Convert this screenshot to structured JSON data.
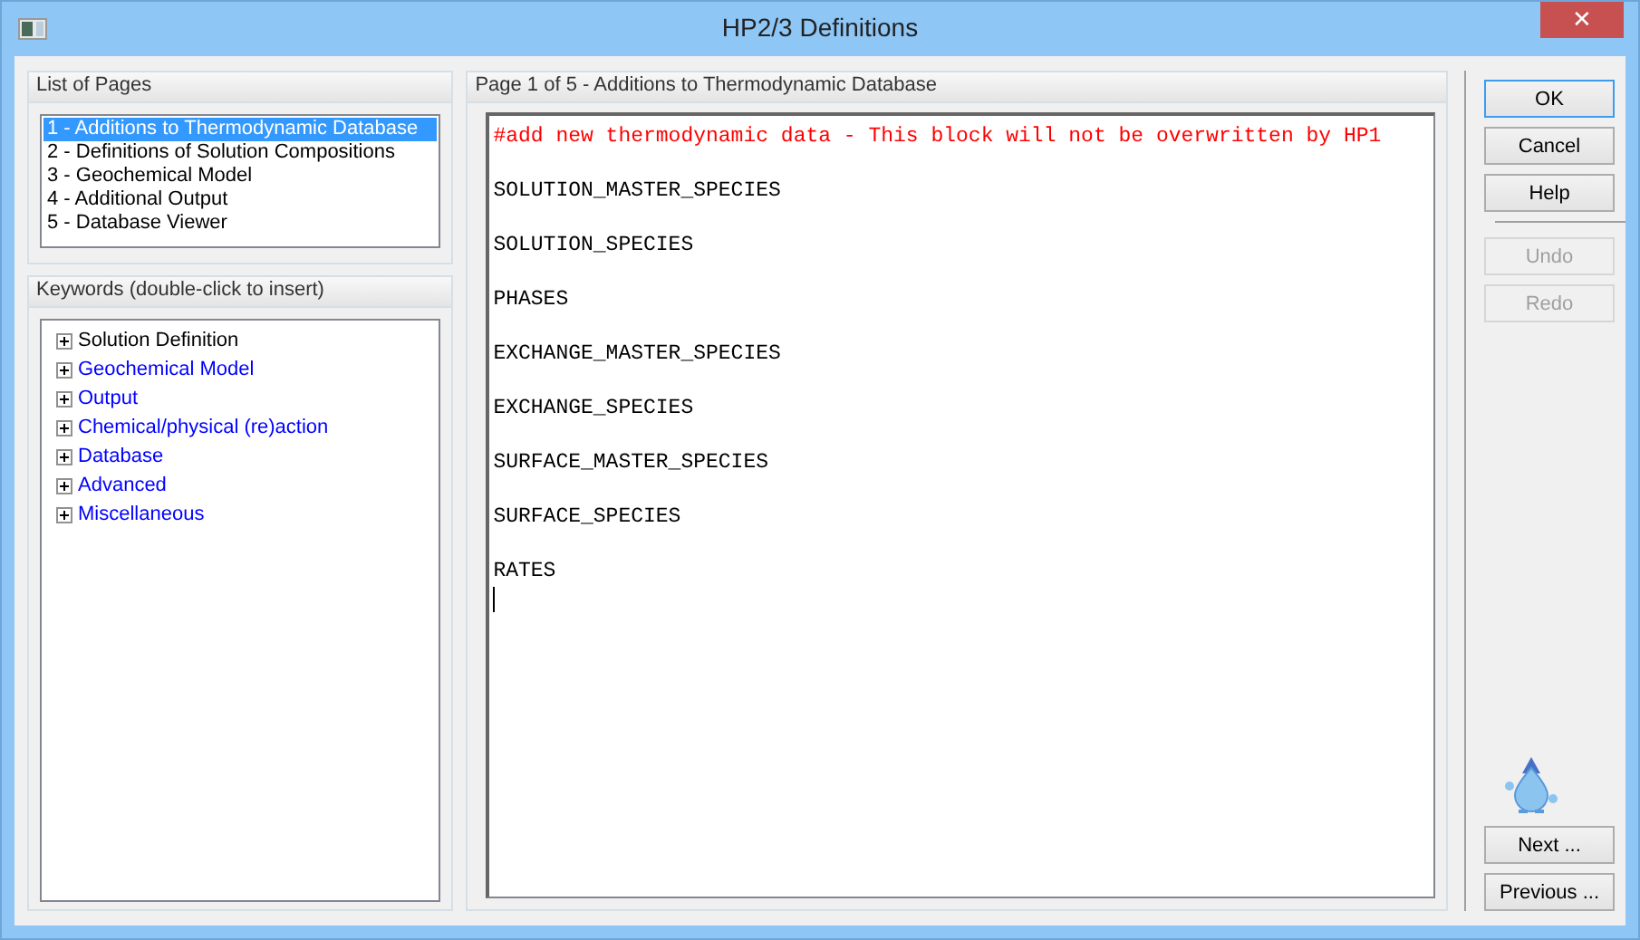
{
  "window": {
    "title": "HP2/3 Definitions",
    "close": "✕"
  },
  "pages_group": {
    "title": "List of Pages",
    "items": [
      {
        "label": "1 - Additions to Thermodynamic Database",
        "selected": true
      },
      {
        "label": "2 - Definitions of Solution Compositions",
        "selected": false
      },
      {
        "label": "3 - Geochemical Model",
        "selected": false
      },
      {
        "label": "4 - Additional Output",
        "selected": false
      },
      {
        "label": "5 - Database Viewer",
        "selected": false
      }
    ]
  },
  "keywords_group": {
    "title": "Keywords (double-click to insert)",
    "items": [
      {
        "label": "Solution Definition",
        "color": "#000000",
        "expanded": false
      },
      {
        "label": "Geochemical Model",
        "color": "#0000ff",
        "expanded": false
      },
      {
        "label": "Output",
        "color": "#0000ff",
        "expanded": false
      },
      {
        "label": "Chemical/physical (re)action",
        "color": "#0000ff",
        "expanded": false
      },
      {
        "label": "Database",
        "color": "#0000ff",
        "expanded": false
      },
      {
        "label": "Advanced",
        "color": "#0000ff",
        "expanded": false
      },
      {
        "label": "Miscellaneous",
        "color": "#0000ff",
        "expanded": false
      }
    ]
  },
  "editor": {
    "title": "Page 1 of 5 - Additions to Thermodynamic Database",
    "lines": [
      {
        "text": "#add new thermodynamic data - This block will not be overwritten by HP1",
        "kind": "comment"
      },
      {
        "text": "SOLUTION_MASTER_SPECIES",
        "kind": "keyword"
      },
      {
        "text": "SOLUTION_SPECIES",
        "kind": "keyword"
      },
      {
        "text": "PHASES",
        "kind": "keyword"
      },
      {
        "text": "EXCHANGE_MASTER_SPECIES",
        "kind": "keyword"
      },
      {
        "text": "EXCHANGE_SPECIES",
        "kind": "keyword"
      },
      {
        "text": "SURFACE_MASTER_SPECIES",
        "kind": "keyword"
      },
      {
        "text": "SURFACE_SPECIES",
        "kind": "keyword"
      },
      {
        "text": "RATES",
        "kind": "keyword"
      }
    ]
  },
  "buttons_top": [
    {
      "label": "OK",
      "default": true,
      "disabled": false
    },
    {
      "label": "Cancel",
      "default": false,
      "disabled": false
    },
    {
      "label": "Help",
      "default": false,
      "disabled": false
    }
  ],
  "buttons_edit": [
    {
      "label": "Undo",
      "default": false,
      "disabled": true
    },
    {
      "label": "Redo",
      "default": false,
      "disabled": true
    }
  ],
  "buttons_nav": [
    {
      "label": "Next ...",
      "default": false,
      "disabled": false
    },
    {
      "label": "Previous ...",
      "default": false,
      "disabled": false
    }
  ]
}
